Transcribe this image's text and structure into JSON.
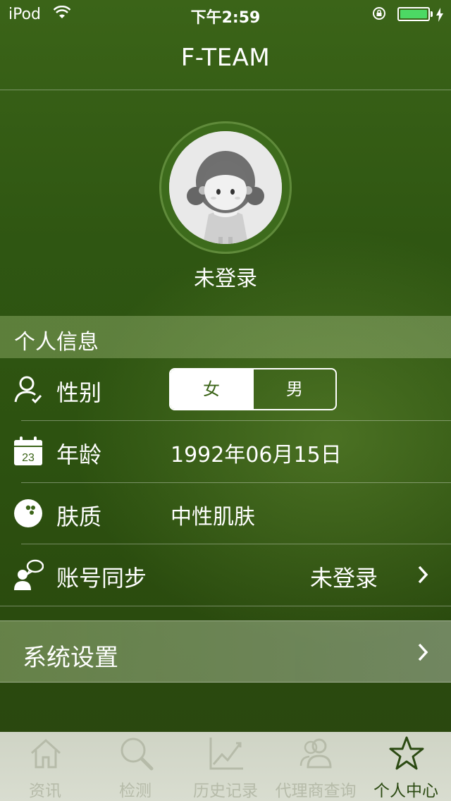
{
  "status_bar": {
    "carrier": "iPod",
    "time": "下午2:59",
    "battery_level": 1.0,
    "battery_color": "#4cd964"
  },
  "nav": {
    "title": "F-TEAM"
  },
  "profile": {
    "avatar_icon": "girl-avatar",
    "login_status": "未登录"
  },
  "section": {
    "title": "个人信息"
  },
  "rows": {
    "gender": {
      "label": "性别",
      "icon": "person-check-icon",
      "options": [
        "女",
        "男"
      ],
      "selected": "女"
    },
    "age": {
      "label": "年龄",
      "icon": "calendar-icon",
      "calendar_day": "23",
      "value": "1992年06月15日"
    },
    "skin": {
      "label": "肤质",
      "icon": "bowling-ball-icon",
      "value": "中性肌肤"
    },
    "sync": {
      "label": "账号同步",
      "icon": "chat-user-icon",
      "value": "未登录"
    }
  },
  "settings": {
    "label": "系统设置"
  },
  "tabbar": {
    "tabs": [
      {
        "label": "资讯",
        "icon": "home-icon"
      },
      {
        "label": "检测",
        "icon": "magnifier-icon"
      },
      {
        "label": "历史记录",
        "icon": "line-chart-icon"
      },
      {
        "label": "代理商查询",
        "icon": "users-icon"
      },
      {
        "label": "个人中心",
        "icon": "star-icon"
      }
    ],
    "active_index": 4
  },
  "colors": {
    "accent": "#3b6418",
    "tab_inactive": "#b6bba9",
    "tab_active": "#2b4a12"
  }
}
